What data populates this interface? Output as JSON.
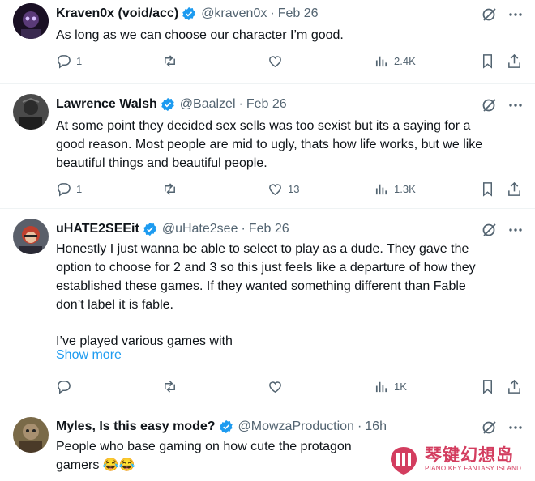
{
  "tweets": [
    {
      "name": "Kraven0x (void/acc)",
      "handle": "@kraven0x",
      "time": "Feb 26",
      "lines": [
        "As long as we can choose our character I’m good."
      ],
      "replies": "1",
      "reposts": "",
      "likes": "",
      "views": "2.4K",
      "avatar_color": "#2a1a3a"
    },
    {
      "name": "Lawrence Walsh",
      "handle": "@Baalzel",
      "time": "Feb 26",
      "lines": [
        "At some point they decided sex sells was too sexist but its a saying for a",
        "good reason.  Most people are mid to ugly, thats how life works, but we like",
        "beautiful things and beautiful people."
      ],
      "replies": "1",
      "reposts": "",
      "likes": "13",
      "views": "1.3K",
      "avatar_color": "#3b3b3b"
    },
    {
      "name": "uHATE2SEEit",
      "handle": "@uHate2see",
      "time": "Feb 26",
      "lines": [
        "Honestly I just wanna be able to select to play as a dude. They gave the",
        "option to choose for 2 and 3 so this just feels like a departure of how they",
        "established these games. If they wanted something different than Fable",
        "don’t label it is fable.",
        "",
        "I’ve played various games with"
      ],
      "show_more": "Show more",
      "replies": "",
      "reposts": "",
      "likes": "",
      "views": "1K",
      "avatar_color": "#8a2a2a"
    },
    {
      "name": "Myles, Is this easy mode?",
      "handle": "@MowzaProduction",
      "time": "16h",
      "lines": [
        "People who base gaming on how cute the protagon",
        "gamers 😂😂"
      ],
      "avatar_color": "#6b5a3a"
    }
  ],
  "watermark": {
    "title": "琴键幻想岛",
    "subtitle": "PIANO KEY FANTASY ISLAND"
  },
  "colors": {
    "verified": "#1d9bf0",
    "muted": "#536471",
    "link": "#1d9bf0",
    "watermark": "#d33d5f"
  }
}
